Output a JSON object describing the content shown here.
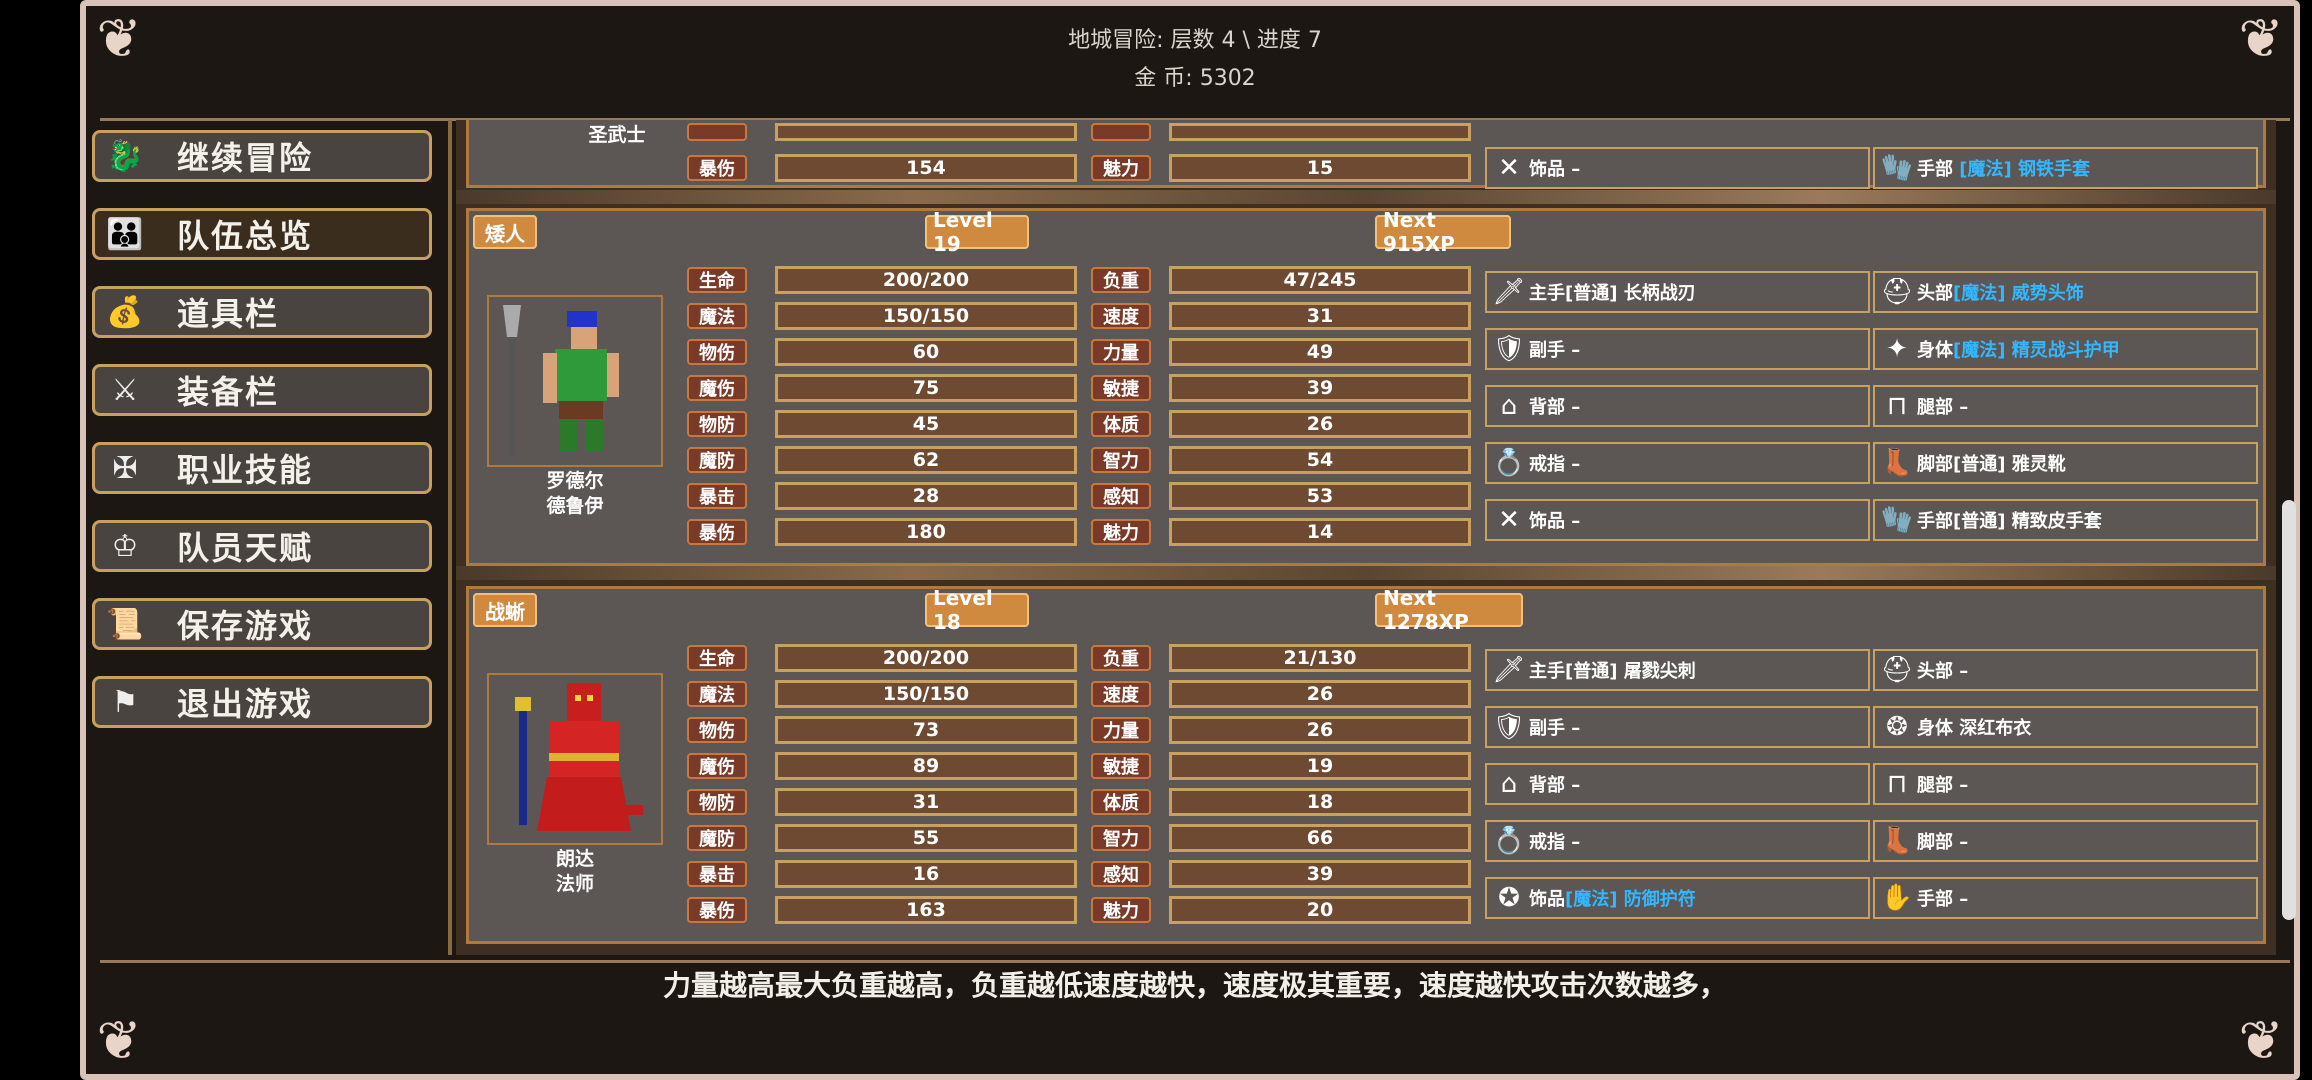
{
  "header": {
    "dungeon_line": "地城冒险: 层数 4 \\ 进度 7",
    "gold_line": "金      币: 5302"
  },
  "sidebar": {
    "items": [
      {
        "label": "继续冒险",
        "icon": "dragon-icon"
      },
      {
        "label": "队伍总览",
        "icon": "party-icon"
      },
      {
        "label": "道具栏",
        "icon": "bag-icon"
      },
      {
        "label": "装备栏",
        "icon": "sword-shield-icon"
      },
      {
        "label": "职业技能",
        "icon": "winged-sword-icon"
      },
      {
        "label": "队员天赋",
        "icon": "laurel-crown-icon"
      },
      {
        "label": "保存游戏",
        "icon": "scroll-icon"
      },
      {
        "label": "退出游戏",
        "icon": "flag-icon"
      }
    ]
  },
  "stat_labels_left": [
    "生命",
    "魔法",
    "物伤",
    "魔伤",
    "物防",
    "魔防",
    "暴击",
    "暴伤"
  ],
  "stat_labels_right": [
    "负重",
    "速度",
    "力量",
    "敏捷",
    "体质",
    "智力",
    "感知",
    "魅力"
  ],
  "partial_panel": {
    "name_line": "圣武士",
    "label_left": "暴伤",
    "value_left": "154",
    "label_right": "魅力",
    "value_right": "15",
    "equip_left": {
      "slot": "饰品",
      "value": "–"
    },
    "equip_right": {
      "slot": "手部",
      "quality": "[魔法]",
      "item": "钢铁手套"
    }
  },
  "characters": [
    {
      "race": "矮人",
      "level": "Level 19",
      "next": "Next 915XP",
      "name": "罗德尔",
      "class": "德鲁伊",
      "left_values": [
        "200/200",
        "150/150",
        "60",
        "75",
        "45",
        "62",
        "28",
        "180"
      ],
      "right_values": [
        "47/245",
        "31",
        "49",
        "39",
        "26",
        "54",
        "53",
        "14"
      ],
      "equip_left": [
        {
          "slot": "主手",
          "quality": "[普通]",
          "item": "长柄战刃"
        },
        {
          "slot": "副手",
          "quality": "",
          "item": "–"
        },
        {
          "slot": "背部",
          "quality": "",
          "item": "–"
        },
        {
          "slot": "戒指",
          "quality": "",
          "item": "–"
        },
        {
          "slot": "饰品",
          "quality": "",
          "item": "–"
        }
      ],
      "equip_right": [
        {
          "slot": "头部",
          "quality": "[魔法]",
          "item": "威势头饰"
        },
        {
          "slot": "身体",
          "quality": "[魔法]",
          "item": "精灵战斗护甲"
        },
        {
          "slot": "腿部",
          "quality": "",
          "item": "–"
        },
        {
          "slot": "脚部",
          "quality": "[普通]",
          "item": "雅灵靴"
        },
        {
          "slot": "手部",
          "quality": "[普通]",
          "item": "精致皮手套"
        }
      ]
    },
    {
      "race": "战蜥",
      "level": "Level 18",
      "next": "Next 1278XP",
      "name": "朗达",
      "class": "法师",
      "left_values": [
        "200/200",
        "150/150",
        "73",
        "89",
        "31",
        "55",
        "16",
        "163"
      ],
      "right_values": [
        "21/130",
        "26",
        "26",
        "19",
        "18",
        "66",
        "39",
        "20"
      ],
      "equip_left": [
        {
          "slot": "主手",
          "quality": "[普通]",
          "item": "屠戮尖刺"
        },
        {
          "slot": "副手",
          "quality": "",
          "item": "–"
        },
        {
          "slot": "背部",
          "quality": "",
          "item": "–"
        },
        {
          "slot": "戒指",
          "quality": "",
          "item": "–"
        },
        {
          "slot": "饰品",
          "quality": "[魔法]",
          "item": "防御护符"
        }
      ],
      "equip_right": [
        {
          "slot": "头部",
          "quality": "",
          "item": "–"
        },
        {
          "slot": "身体",
          "quality": "",
          "item": "深红布衣"
        },
        {
          "slot": "腿部",
          "quality": "",
          "item": "–"
        },
        {
          "slot": "脚部",
          "quality": "",
          "item": "–"
        },
        {
          "slot": "手部",
          "quality": "",
          "item": "–"
        }
      ]
    }
  ],
  "tip": "力量越高最大负重越高，负重越低速度越快，速度极其重要，速度越快攻击次数越多，"
}
